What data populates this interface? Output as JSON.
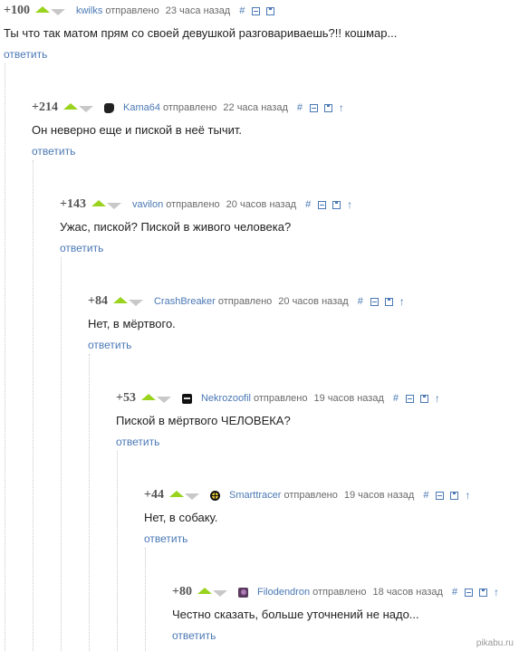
{
  "comments": [
    {
      "rating": "+100",
      "author": "kwilks",
      "posted": "отправлено",
      "time": "23 часа назад",
      "text": "Ты что так матом прям со своей девушкой разговариваешь?!! кошмар...",
      "reply": "ответить",
      "avatar": "none",
      "has_parent_link": false
    },
    {
      "rating": "+214",
      "author": "Kama64",
      "posted": "отправлено",
      "time": "22 часа назад",
      "text": "Он неверно еще и пиской в неё тычит.",
      "reply": "ответить",
      "avatar": "dark-square",
      "has_parent_link": true
    },
    {
      "rating": "+143",
      "author": "vavilon",
      "posted": "отправлено",
      "time": "20 часов назад",
      "text": "Ужас, пиской? Пиской в живого человека?",
      "reply": "ответить",
      "avatar": "none",
      "has_parent_link": true
    },
    {
      "rating": "+84",
      "author": "CrashBreaker",
      "posted": "отправлено",
      "time": "20 часов назад",
      "text": "Нет, в мёртвого.",
      "reply": "ответить",
      "avatar": "none",
      "has_parent_link": true
    },
    {
      "rating": "+53",
      "author": "Nekrozoofil",
      "posted": "отправлено",
      "time": "19 часов назад",
      "text": "Пиской в мёртвого ЧЕЛОВЕКА?",
      "reply": "ответить",
      "avatar": "black-face",
      "has_parent_link": true
    },
    {
      "rating": "+44",
      "author": "Smarttracer",
      "posted": "отправлено",
      "time": "19 часов назад",
      "text": "Нет, в собаку.",
      "reply": "ответить",
      "avatar": "yellow-crosshair",
      "has_parent_link": true
    },
    {
      "rating": "+80",
      "author": "Filodendron",
      "posted": "отправлено",
      "time": "18 часов назад",
      "text": "Честно сказать, больше уточнений не надо...",
      "reply": "ответить",
      "avatar": "purple-plant",
      "has_parent_link": true
    }
  ],
  "tools": {
    "permalink": "#"
  },
  "watermark": "pikabu.ru",
  "colors": {
    "vote_up": "#9ad31e",
    "vote_down": "#c8c8c8",
    "link": "#4a78b4"
  }
}
